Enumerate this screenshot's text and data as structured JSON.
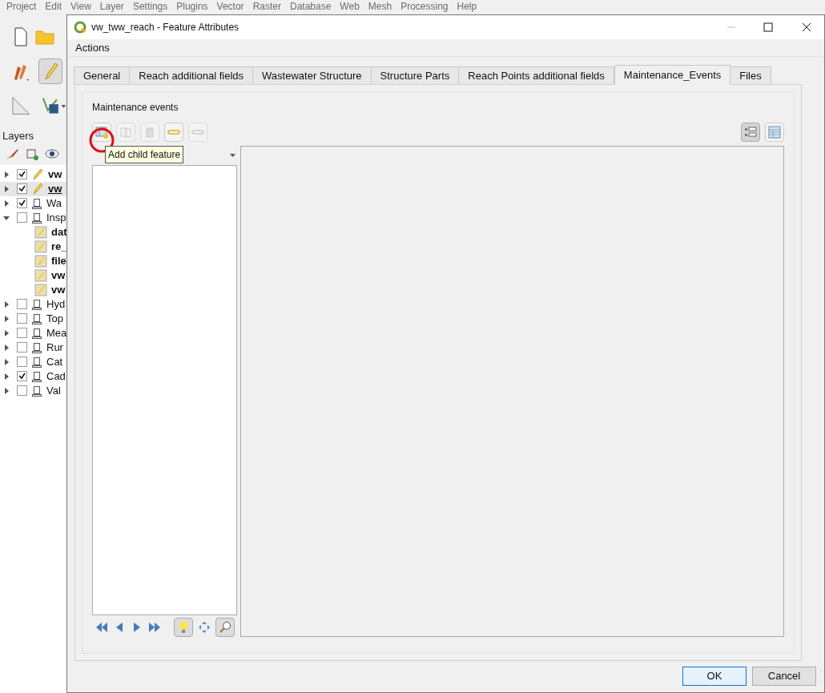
{
  "main_menu": [
    "Project",
    "Edit",
    "View",
    "Layer",
    "Settings",
    "Plugins",
    "Vector",
    "Raster",
    "Database",
    "Web",
    "Mesh",
    "Processing",
    "Help"
  ],
  "layers_panel": {
    "title": "Layers",
    "items": [
      {
        "name": "vw",
        "kind": "edit",
        "checked": true,
        "bold": true,
        "selected": false,
        "expanded": false
      },
      {
        "name": "vw",
        "kind": "edit",
        "checked": true,
        "bold": true,
        "selected": true,
        "expanded": false
      },
      {
        "name": "Wa",
        "kind": "group",
        "checked": true,
        "bold": false,
        "selected": false,
        "expanded": false
      },
      {
        "name": "Insp",
        "kind": "group",
        "checked": false,
        "bold": false,
        "selected": false,
        "expanded": true,
        "children": [
          {
            "name": "dat",
            "kind": "table",
            "bold": true
          },
          {
            "name": "re_",
            "kind": "table",
            "bold": true
          },
          {
            "name": "file",
            "kind": "table",
            "bold": true
          },
          {
            "name": "vw",
            "kind": "table",
            "bold": true
          },
          {
            "name": "vw",
            "kind": "table",
            "bold": true
          }
        ]
      },
      {
        "name": "Hyd",
        "kind": "group",
        "checked": false,
        "bold": false,
        "selected": false,
        "expanded": false
      },
      {
        "name": "Top",
        "kind": "group",
        "checked": false,
        "bold": false,
        "selected": false,
        "expanded": false
      },
      {
        "name": "Mea",
        "kind": "group",
        "checked": false,
        "bold": false,
        "selected": false,
        "expanded": false
      },
      {
        "name": "Rur",
        "kind": "group",
        "checked": false,
        "bold": false,
        "selected": false,
        "expanded": false
      },
      {
        "name": "Cat",
        "kind": "group",
        "checked": false,
        "bold": false,
        "selected": false,
        "expanded": false
      },
      {
        "name": "Cad",
        "kind": "group",
        "checked": true,
        "bold": false,
        "selected": false,
        "expanded": false
      },
      {
        "name": "Val",
        "kind": "group",
        "checked": false,
        "bold": false,
        "selected": false,
        "expanded": false
      }
    ]
  },
  "dialog": {
    "title": "vw_tww_reach - Feature Attributes",
    "menu": [
      "Actions"
    ],
    "tabs": [
      {
        "label": "General",
        "selected": false
      },
      {
        "label": "Reach additional fields",
        "selected": false
      },
      {
        "label": "Wastewater Structure",
        "selected": false
      },
      {
        "label": "Structure Parts",
        "selected": false
      },
      {
        "label": "Reach Points additional fields",
        "selected": false
      },
      {
        "label": "Maintenance_Events",
        "selected": true
      },
      {
        "label": "Files",
        "selected": false
      }
    ],
    "section_title": "Maintenance events",
    "tooltip": "Add child feature",
    "view_toggle": [
      {
        "kind": "form",
        "selected": true
      },
      {
        "kind": "table",
        "selected": false
      }
    ],
    "buttons": [
      "OK",
      "Cancel"
    ]
  }
}
